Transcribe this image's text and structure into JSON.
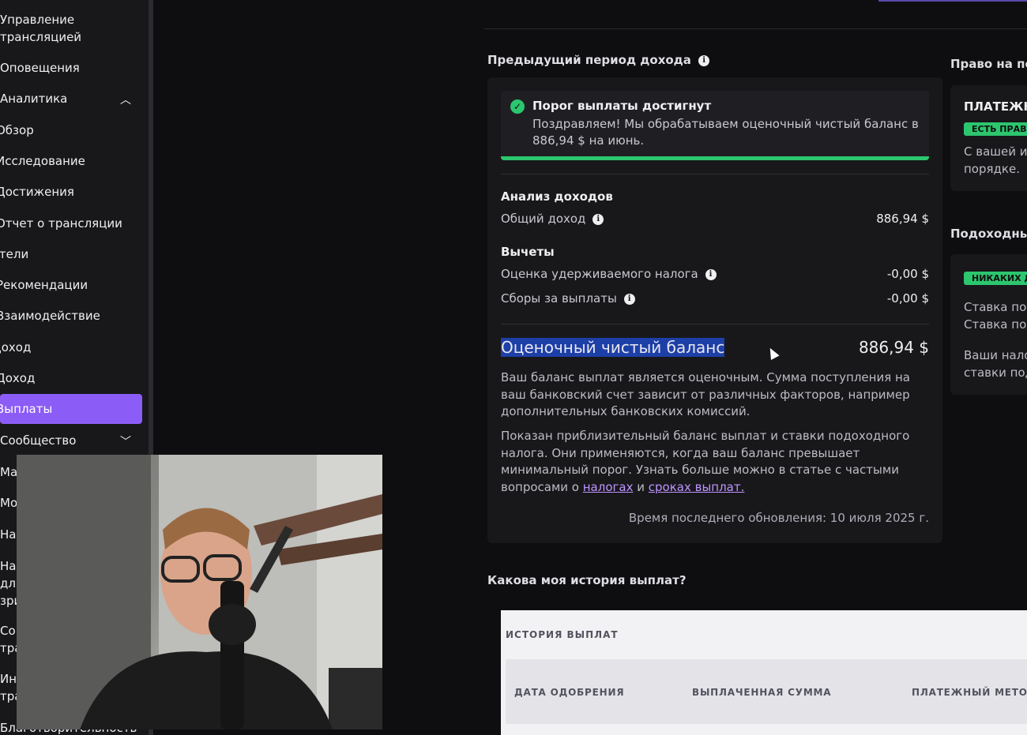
{
  "sidebar": {
    "items": [
      {
        "label": "Управление трансляцией"
      },
      {
        "label": "Оповещения"
      },
      {
        "label": "Аналитика"
      },
      {
        "label": "Обзор"
      },
      {
        "label": "Исследование"
      },
      {
        "label": "Достижения"
      },
      {
        "label": "Отчет о трансляции"
      },
      {
        "label": "Зрители"
      },
      {
        "label": "Рекомендации"
      },
      {
        "label": "Взаимодействие"
      },
      {
        "label": "Доход"
      },
      {
        "label": "Доход"
      },
      {
        "label": "Выплаты"
      },
      {
        "label": "Сообщество"
      },
      {
        "label": "Благотворительность"
      }
    ],
    "fragments": [
      "Ма",
      "Мо",
      "На",
      "На",
      "для",
      "зри",
      "Со",
      "тра",
      "Ин",
      "тра"
    ]
  },
  "previous_period": {
    "title": "Предыдущий период дохода",
    "alert_title": "Порог выплаты достигнут",
    "alert_text": "Поздравляем! Мы обрабатываем оценочный чистый баланс в 886,94 $ на июнь.",
    "analysis_title": "Анализ доходов",
    "total_label": "Общий доход",
    "total_value": "886,94 $",
    "deductions_title": "Вычеты",
    "tax_label": "Оценка удерживаемого налога",
    "tax_value": "-0,00 $",
    "fees_label": "Сборы за выплаты",
    "fees_value": "-0,00 $",
    "net_label": "Оценочный чистый баланс",
    "net_value": "886,94 $",
    "para1": "Ваш баланс выплат является оценочным. Сумма поступления на ваш банковский счет зависит от различных факторов, например дополнительных банковских комиссий.",
    "para2_start": "Показан приблизительный баланс выплат и ставки подоходного налога. Они применяются, когда ваш баланс превышает минимальный порог. Узнать больше можно в статье с частыми вопросами о ",
    "link_taxes": "налогах",
    "para2_mid": " и ",
    "link_terms": "сроках выплат.",
    "updated": "Время последнего обновления: 10 июля 2025 г."
  },
  "right_column": {
    "title1": "Право на пол",
    "card1_heading": "ПЛАТЕЖН",
    "card1_badge": "ЕСТЬ ПРАВО",
    "card1_line1": "С вашей и",
    "card1_line2": "порядке.",
    "title2": "Подоходный",
    "card2_badge": "НИКАКИХ Д",
    "card2_line1": "Ставка под",
    "card2_line2": "Ставка под",
    "card2_line3": "Ваши нало",
    "card2_line4": "ставки под"
  },
  "history": {
    "question": "Какова моя история выплат?",
    "table_title": "ИСТОРИЯ ВЫПЛАТ",
    "col_date": "ДАТА ОДОБРЕНИЯ",
    "col_amount": "ВЫПЛАЧЕННАЯ СУММА",
    "col_method": "ПЛАТЕЖНЫЙ МЕТОД"
  },
  "colors": {
    "accent": "#8c5cf6",
    "success": "#2cc66e",
    "link": "#bf94ff",
    "selection": "#1d3fa8"
  },
  "icons": {
    "info": "info-icon",
    "check": "check-circle-icon",
    "chevron_up": "chevron-up-icon",
    "chevron_down": "chevron-down-icon",
    "cursor": "mouse-cursor-icon"
  }
}
